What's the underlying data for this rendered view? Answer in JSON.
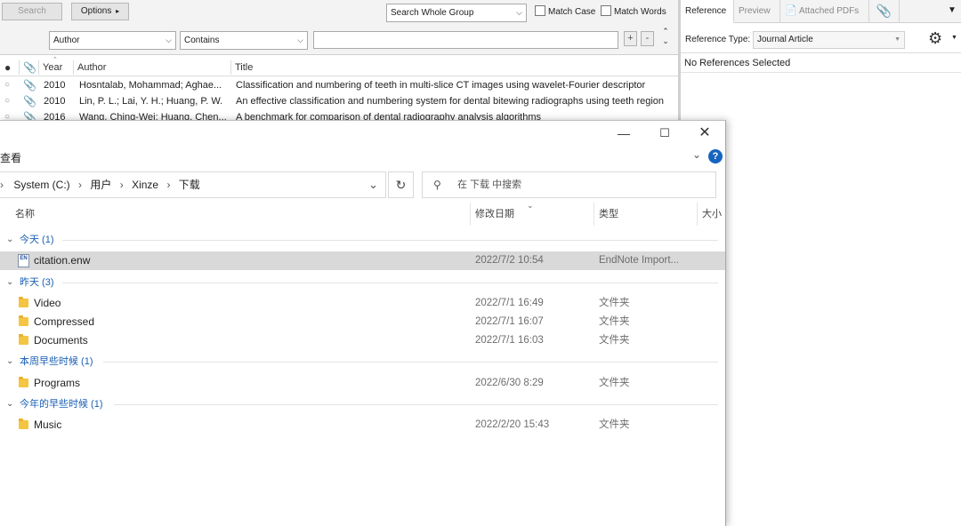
{
  "endnote": {
    "search_button": "Search",
    "options_button": "Options",
    "options_arrow": "▸",
    "scope_select": "Search Whole Group",
    "match_case": "Match Case",
    "match_words": "Match Words",
    "field_select": "Author",
    "condition_select": "Contains",
    "search_value": "",
    "plus": "+",
    "minus": "-",
    "columns": {
      "year": "Year",
      "author": "Author",
      "title": "Title"
    },
    "rows": [
      {
        "year": "2010",
        "author": "Hosntalab, Mohammad; Aghae...",
        "title": "Classification and numbering of teeth in multi-slice CT images using wavelet-Fourier descriptor"
      },
      {
        "year": "2010",
        "author": "Lin, P. L.; Lai, Y. H.; Huang, P. W.",
        "title": "An effective classification and numbering system for dental bitewing radiographs using teeth region"
      },
      {
        "year": "2016",
        "author": "Wang, Ching-Wei; Huang, Chen...",
        "title": "A benchmark for comparison of dental radiography analysis algorithms"
      }
    ],
    "tabs": {
      "reference": "Reference",
      "preview": "Preview",
      "attached_pdfs": "Attached PDFs"
    },
    "reference_type_label": "Reference Type:",
    "reference_type_value": "Journal Article",
    "no_selection": "No References Selected"
  },
  "explorer": {
    "ribbon_view": "查看",
    "breadcrumb": {
      "root": "System (C:)",
      "users": "用户",
      "user": "Xinze",
      "folder": "下载"
    },
    "search_placeholder": "在 下载 中搜索",
    "columns": {
      "name": "名称",
      "modified": "修改日期",
      "type": "类型",
      "size": "大小"
    },
    "groups": [
      {
        "label": "今天 (1)",
        "items": [
          {
            "name": "citation.enw",
            "date": "2022/7/2 10:54",
            "type": "EndNote Import...",
            "icon": "enw-file-icon",
            "selected": true
          }
        ]
      },
      {
        "label": "昨天 (3)",
        "items": [
          {
            "name": "Video",
            "date": "2022/7/1 16:49",
            "type": "文件夹",
            "icon": "folder-icon"
          },
          {
            "name": "Compressed",
            "date": "2022/7/1 16:07",
            "type": "文件夹",
            "icon": "folder-icon"
          },
          {
            "name": "Documents",
            "date": "2022/7/1 16:03",
            "type": "文件夹",
            "icon": "folder-icon"
          }
        ]
      },
      {
        "label": "本周早些时候 (1)",
        "items": [
          {
            "name": "Programs",
            "date": "2022/6/30 8:29",
            "type": "文件夹",
            "icon": "folder-icon"
          }
        ]
      },
      {
        "label": "今年的早些时候 (1)",
        "items": [
          {
            "name": "Music",
            "date": "2022/2/20 15:43",
            "type": "文件夹",
            "icon": "folder-icon"
          }
        ]
      }
    ],
    "enw_icon_text": "EN"
  }
}
